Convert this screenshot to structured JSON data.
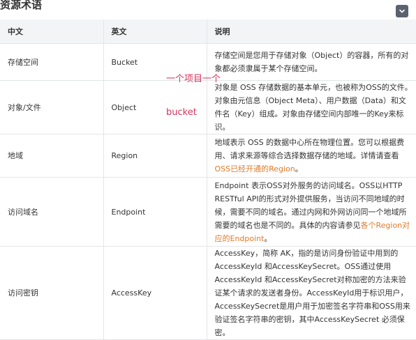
{
  "page": {
    "title": "资源术语",
    "collapse_icon": "chevron-down-icon"
  },
  "table": {
    "headers": [
      "中文",
      "英文",
      "说明"
    ],
    "rows": [
      {
        "zh": "存储空间",
        "en": "Bucket",
        "desc": "存储空间是您用于存储对象（Object）的容器，所有的对象都必须隶属于某个存储空间。"
      },
      {
        "zh": "对象/文件",
        "en": "Object",
        "desc": "对象是 OSS 存储数据的基本单元，也被称为OSS的文件。对象由元信息（Object Meta）、用户数据（Data）和文件名（Key）组成。对象由存储空间内部唯一的Key来标识。"
      },
      {
        "zh": "地域",
        "en": "Region",
        "desc": "地域表示 OSS 的数据中心所在物理位置。您可以根据费用、请求来源等综合选择数据存储的地域。详情请查看",
        "link": "OSS已经开通的Region",
        "desc_end": "。"
      },
      {
        "zh": "访问域名",
        "en": "Endpoint",
        "desc": "Endpoint 表示OSS对外服务的访问域名。OSS以HTTP RESTful API的形式对外提供服务，当访问不同地域的时候，需要不同的域名。通过内网和外网访问同一个地域所需要的域名也是不同的。具体的内容请参见",
        "link": "各个Region对应的Endpoint",
        "desc_end": "。"
      },
      {
        "zh": "访问密钥",
        "en": "AccessKey",
        "desc": "AccessKey，简称 AK，指的是访问身份验证中用到的AccessKeyId 和AccessKeySecret。OSS通过使用AccessKeyId 和AccessKeySecret对称加密的方法来验证某个请求的发送者身份。AccessKeyId用于标识用户，AccessKeySecret是用户用于加密签名字符串和OSS用来验证签名字符串的密钥，其中AccessKeySecret 必须保密。"
      }
    ]
  },
  "annotation": {
    "line1": "一个项目一个",
    "line2": "bucket",
    "color": "#d9345a"
  },
  "colors": {
    "link": "#e07b29",
    "header_bg": "#f3f4f6",
    "button_bg": "#5a6270"
  }
}
